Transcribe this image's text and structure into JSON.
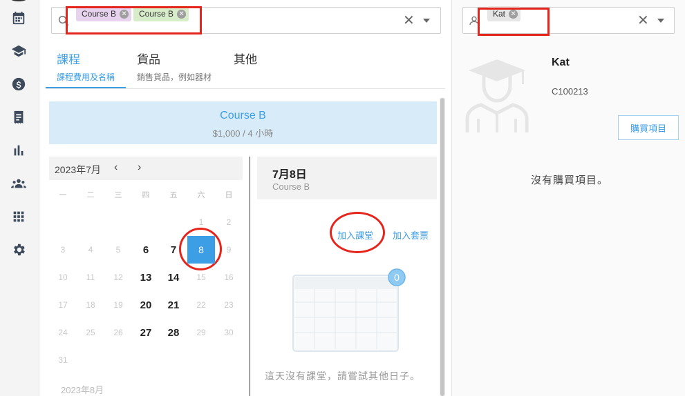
{
  "search": {
    "chips": [
      {
        "label": "Course B",
        "color": "#e8d3ee"
      },
      {
        "label": "Course B",
        "color": "#d7ecc9"
      }
    ],
    "clear": "✕"
  },
  "tabs": [
    {
      "label": "課程",
      "sub": "課程費用及名稱",
      "active": true
    },
    {
      "label": "貨品",
      "sub": "銷售貨品，例如器材",
      "active": false
    },
    {
      "label": "其他",
      "sub": "",
      "active": false
    }
  ],
  "course": {
    "name": "Course B",
    "price": "$1,000 / 4 小時"
  },
  "calendar": {
    "month": "2023年7月",
    "prev": "‹",
    "next": "›",
    "weekdays": [
      "一",
      "二",
      "三",
      "四",
      "五",
      "六",
      "日"
    ],
    "days": [
      {
        "n": "1",
        "col": 5,
        "row": 0
      },
      {
        "n": "2",
        "col": 6,
        "row": 0
      },
      {
        "n": "3",
        "col": 0,
        "row": 1
      },
      {
        "n": "4",
        "col": 1,
        "row": 1
      },
      {
        "n": "5",
        "col": 2,
        "row": 1
      },
      {
        "n": "6",
        "col": 3,
        "row": 1,
        "avail": true
      },
      {
        "n": "7",
        "col": 4,
        "row": 1,
        "avail": true
      },
      {
        "n": "8",
        "col": 5,
        "row": 1,
        "selected": true
      },
      {
        "n": "9",
        "col": 6,
        "row": 1
      },
      {
        "n": "10",
        "col": 0,
        "row": 2
      },
      {
        "n": "11",
        "col": 1,
        "row": 2
      },
      {
        "n": "12",
        "col": 2,
        "row": 2
      },
      {
        "n": "13",
        "col": 3,
        "row": 2,
        "avail": true
      },
      {
        "n": "14",
        "col": 4,
        "row": 2,
        "avail": true
      },
      {
        "n": "15",
        "col": 5,
        "row": 2
      },
      {
        "n": "16",
        "col": 6,
        "row": 2
      },
      {
        "n": "17",
        "col": 0,
        "row": 3
      },
      {
        "n": "18",
        "col": 1,
        "row": 3
      },
      {
        "n": "19",
        "col": 2,
        "row": 3
      },
      {
        "n": "20",
        "col": 3,
        "row": 3,
        "avail": true
      },
      {
        "n": "21",
        "col": 4,
        "row": 3,
        "avail": true
      },
      {
        "n": "22",
        "col": 5,
        "row": 3
      },
      {
        "n": "23",
        "col": 6,
        "row": 3
      },
      {
        "n": "24",
        "col": 0,
        "row": 4
      },
      {
        "n": "25",
        "col": 1,
        "row": 4
      },
      {
        "n": "26",
        "col": 2,
        "row": 4
      },
      {
        "n": "27",
        "col": 3,
        "row": 4,
        "avail": true
      },
      {
        "n": "28",
        "col": 4,
        "row": 4,
        "avail": true
      },
      {
        "n": "29",
        "col": 5,
        "row": 4
      },
      {
        "n": "30",
        "col": 6,
        "row": 4
      },
      {
        "n": "31",
        "col": 0,
        "row": 5
      }
    ],
    "next_month": "2023年8月"
  },
  "day_panel": {
    "date": "7月8日",
    "course": "Course B",
    "join_class": "加入課堂",
    "join_ticket": "加入套票",
    "badge": "0",
    "empty": "這天沒有課堂，請嘗試其他日子。"
  },
  "customer": {
    "chip": "Kat",
    "clear": "✕",
    "name": "Kat",
    "id": "C100213",
    "buy": "購買項目",
    "no_items": "沒有購買項目。"
  },
  "colors": {
    "accent": "#3c9ee5",
    "highlight": "#e5251c"
  }
}
